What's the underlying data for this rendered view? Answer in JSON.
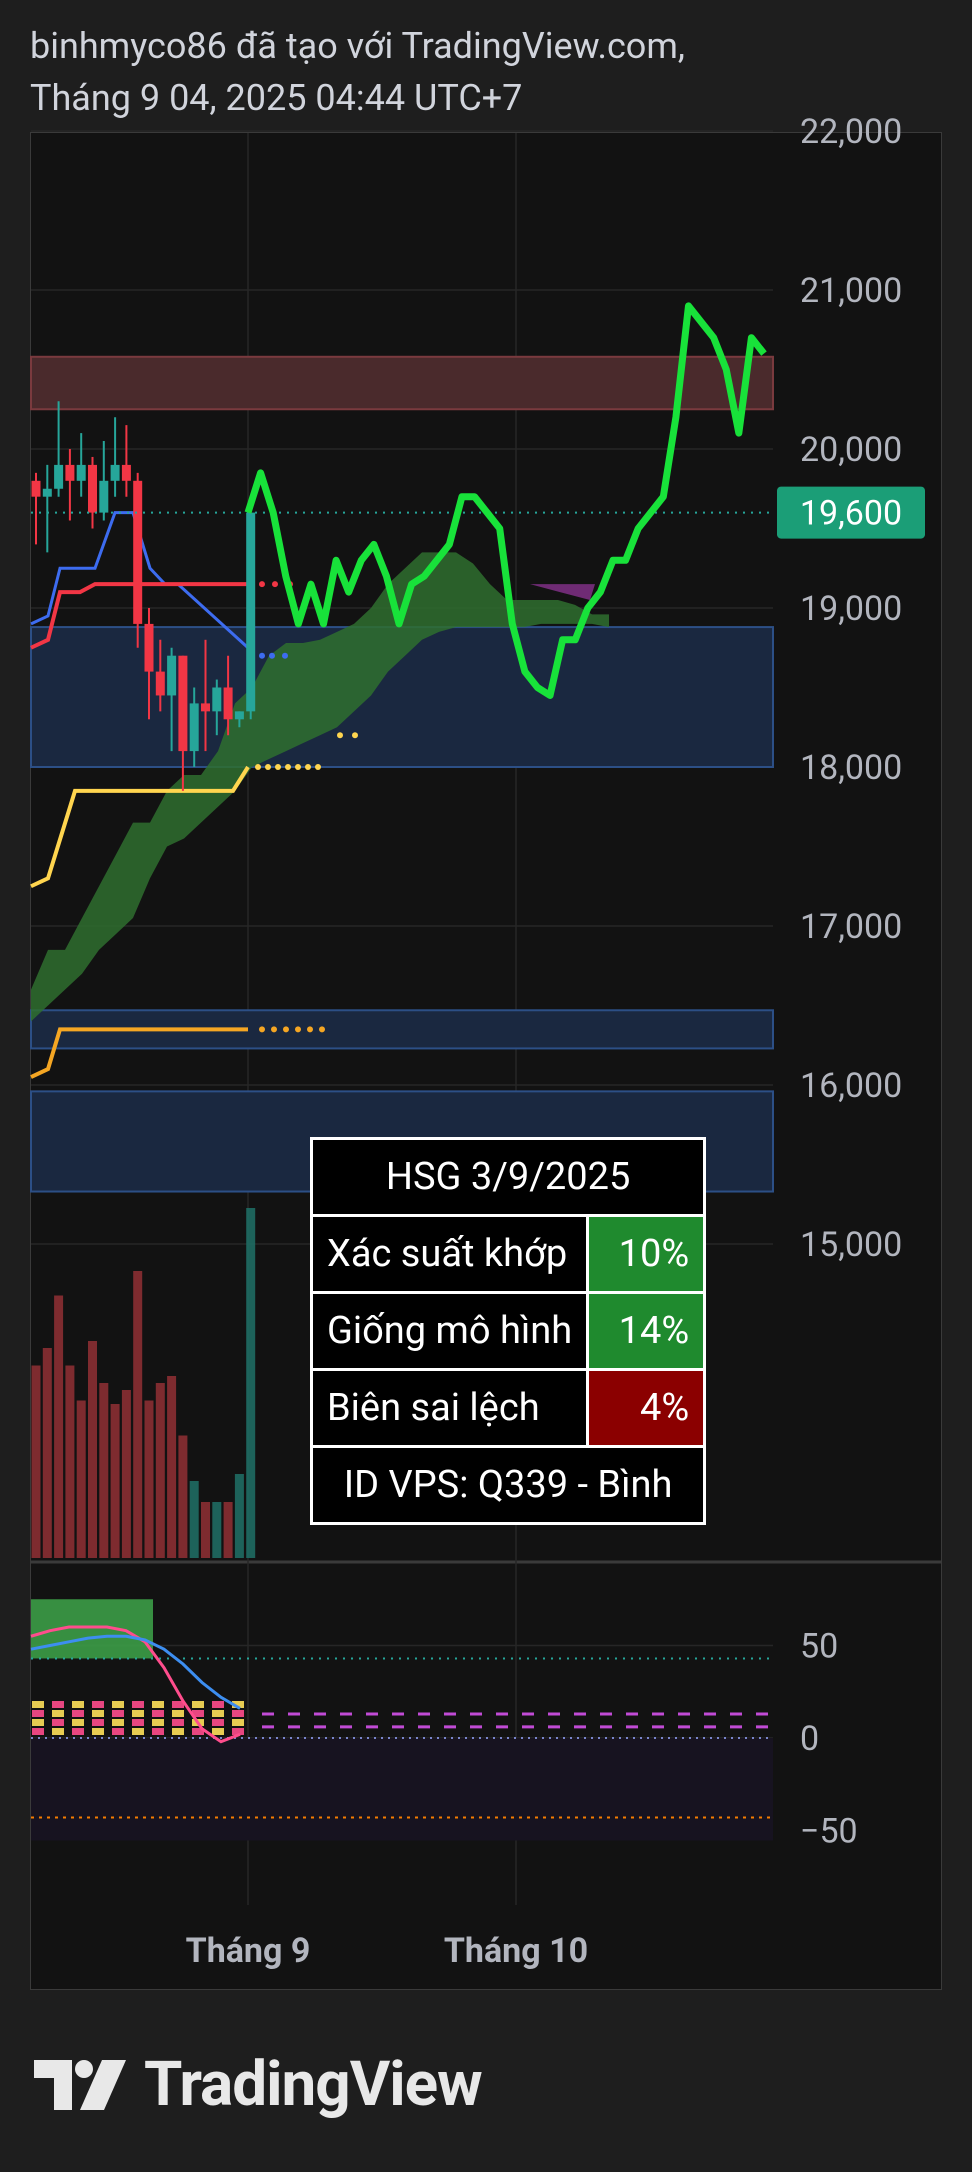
{
  "header": {
    "line1": "binhmyco86 đã tạo với TradingView.com,",
    "line2": "Tháng 9 04, 2025 04:44 UTC+7"
  },
  "chart_data": {
    "type": "line",
    "symbol": "HSG",
    "price_axis_labels": [
      "22,000",
      "21,000",
      "20,000",
      "19,000",
      "18,000",
      "17,000",
      "16,000",
      "15,000"
    ],
    "price_axis_values": [
      22000,
      21000,
      20000,
      19000,
      18000,
      17000,
      16000,
      15000
    ],
    "ylim": [
      14000,
      23000
    ],
    "current_price": 19600,
    "current_price_label": "19,600",
    "oscillator_axis_labels": [
      "50",
      "0",
      "−50"
    ],
    "oscillator_axis_values": [
      50,
      0,
      -50
    ],
    "oscillator_ylim": [
      -85,
      85
    ],
    "time_axis_labels": [
      "Tháng 9",
      "Tháng 10"
    ],
    "resistance_zone": [
      20250,
      20580
    ],
    "support_zone": [
      18000,
      18880
    ],
    "lower_zone_1": [
      16230,
      16470
    ],
    "lower_zone_2": [
      15330,
      15960
    ],
    "projection": [
      19600,
      19850,
      19600,
      19200,
      18900,
      19150,
      18900,
      19300,
      19100,
      19300,
      19400,
      19200,
      18900,
      19150,
      19200,
      19300,
      19400,
      19700,
      19700,
      19600,
      19500,
      18900,
      18600,
      18500,
      18450,
      18800,
      18800,
      19000,
      19100,
      19300,
      19300,
      19500,
      19600,
      19700,
      20200,
      20900,
      20800,
      20700,
      20500,
      20100,
      20700,
      20600
    ],
    "candles": [
      [
        19800,
        19850,
        19400,
        19700
      ],
      [
        19700,
        19900,
        19350,
        19750
      ],
      [
        19750,
        20300,
        19700,
        19900
      ],
      [
        19900,
        20000,
        19550,
        19800
      ],
      [
        19800,
        20100,
        19700,
        19900
      ],
      [
        19900,
        19950,
        19500,
        19600
      ],
      [
        19600,
        20050,
        19550,
        19800
      ],
      [
        19800,
        20200,
        19700,
        19900
      ],
      [
        19900,
        20150,
        19700,
        19800
      ],
      [
        19800,
        19850,
        18750,
        18900
      ],
      [
        18900,
        19000,
        18300,
        18600
      ],
      [
        18600,
        18800,
        18350,
        18450
      ],
      [
        18450,
        18750,
        18100,
        18700
      ],
      [
        18700,
        18700,
        17850,
        18100
      ],
      [
        18100,
        18500,
        18000,
        18400
      ],
      [
        18400,
        18800,
        18100,
        18350
      ],
      [
        18350,
        18550,
        18200,
        18500
      ],
      [
        18500,
        18700,
        18200,
        18300
      ],
      [
        18300,
        18350,
        18250,
        18350
      ],
      [
        18350,
        19600,
        18300,
        19600
      ]
    ],
    "volume": [
      0.55,
      0.6,
      0.75,
      0.55,
      0.45,
      0.62,
      0.5,
      0.44,
      0.48,
      0.82,
      0.45,
      0.5,
      0.52,
      0.35,
      0.22,
      0.16,
      0.16,
      0.16,
      0.24,
      1.0
    ],
    "volume_up": [
      false,
      false,
      false,
      false,
      false,
      false,
      false,
      false,
      false,
      false,
      false,
      false,
      false,
      false,
      true,
      false,
      true,
      false,
      true,
      true
    ],
    "prediction_table": {
      "title": "HSG 3/9/2025",
      "rows": [
        {
          "label": "Xác suất khớp",
          "value": "10%",
          "color": "#1f8a2e"
        },
        {
          "label": "Giống mô hình",
          "value": "14%",
          "color": "#1f8a2e"
        },
        {
          "label": "Biên sai lệch",
          "value": "4%",
          "color": "#8b0000"
        }
      ],
      "footer": "ID VPS: Q339 - Bình"
    },
    "colors": {
      "projection": "#18e23a",
      "price_tag": "#1b9e77",
      "resistance_zone": "#4a2a2c",
      "support_zone": "#1a2840",
      "cloud": "#2f6e2f",
      "kijun": "#f23645",
      "tenkan": "#3d6cf0",
      "lagging_span": "#ffd54f",
      "long_ma": "#f5a623"
    }
  },
  "brand": {
    "logo_text": "TradingView"
  }
}
